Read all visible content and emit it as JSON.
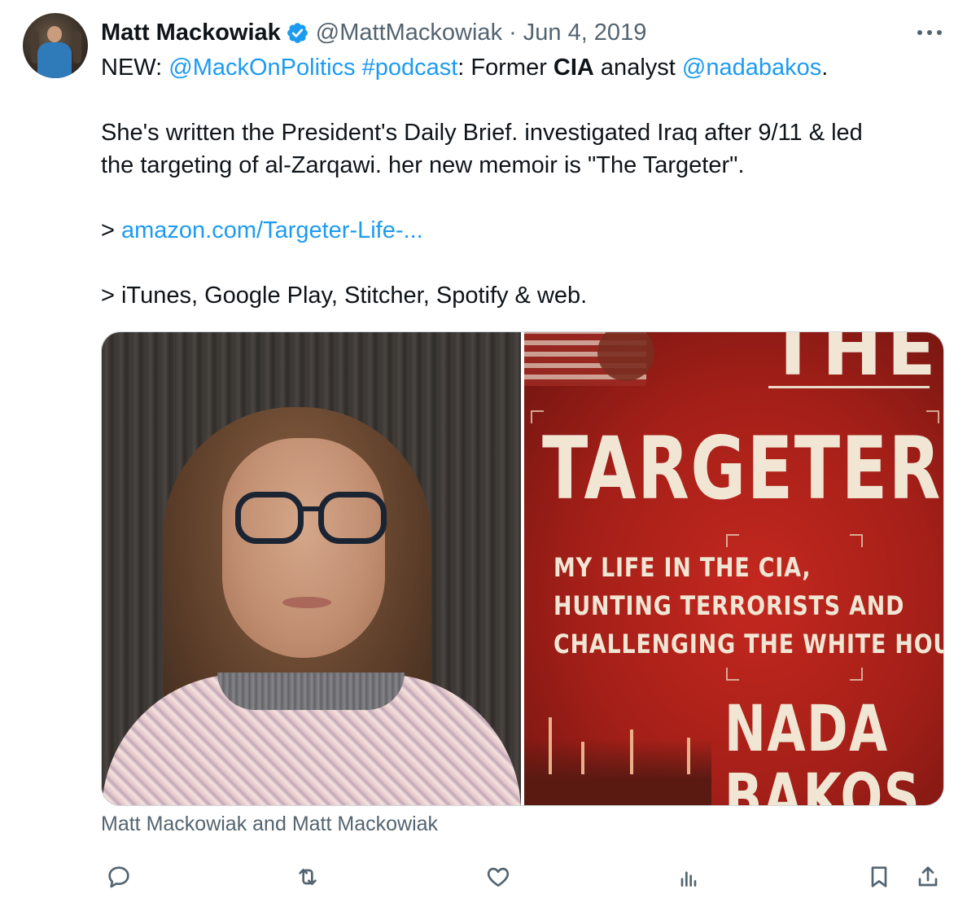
{
  "tweet": {
    "author_name": "Matt Mackowiak",
    "verified": true,
    "handle": "@MattMackowiak",
    "separator": "·",
    "date": "Jun 4, 2019",
    "text": {
      "line1": {
        "prefix": "NEW: ",
        "mention1": "@MackOnPolitics",
        "space": " ",
        "hashtag": "#podcast",
        "middle": ": Former ",
        "bold_word": "CIA",
        "after_bold": " analyst ",
        "mention2": "@nadabakos",
        "end": "."
      },
      "line2": "She's written the President's Daily Brief. investigated Iraq after 9/11 & led",
      "line3": "the targeting of al-Zarqawi. her new memoir is \"The Targeter\".",
      "line4": {
        "prefix": "> ",
        "link": "amazon.com/Targeter-Life-..."
      },
      "line5": "> iTunes, Google Play, Stitcher, Spotify & web."
    },
    "media": {
      "cover": {
        "top_word": "THE",
        "title": "TARGETER",
        "subtitle_lines": [
          "MY LIFE IN THE CIA,",
          "HUNTING TERRORISTS AND",
          "CHALLENGING THE WHITE HOUSE"
        ],
        "author_lines": [
          "NADA",
          "BAKOS"
        ]
      }
    },
    "caption": "Matt Mackowiak and Matt Mackowiak",
    "actions": [
      "reply-icon",
      "retweet-icon",
      "like-icon",
      "views-icon",
      "bookmark-icon",
      "share-icon"
    ]
  },
  "colors": {
    "link": "#1d9bf0",
    "verified": "#1d9bf0",
    "secondary_text": "#536471",
    "primary_text": "#0f1419",
    "cover_red": "#b8241c"
  }
}
